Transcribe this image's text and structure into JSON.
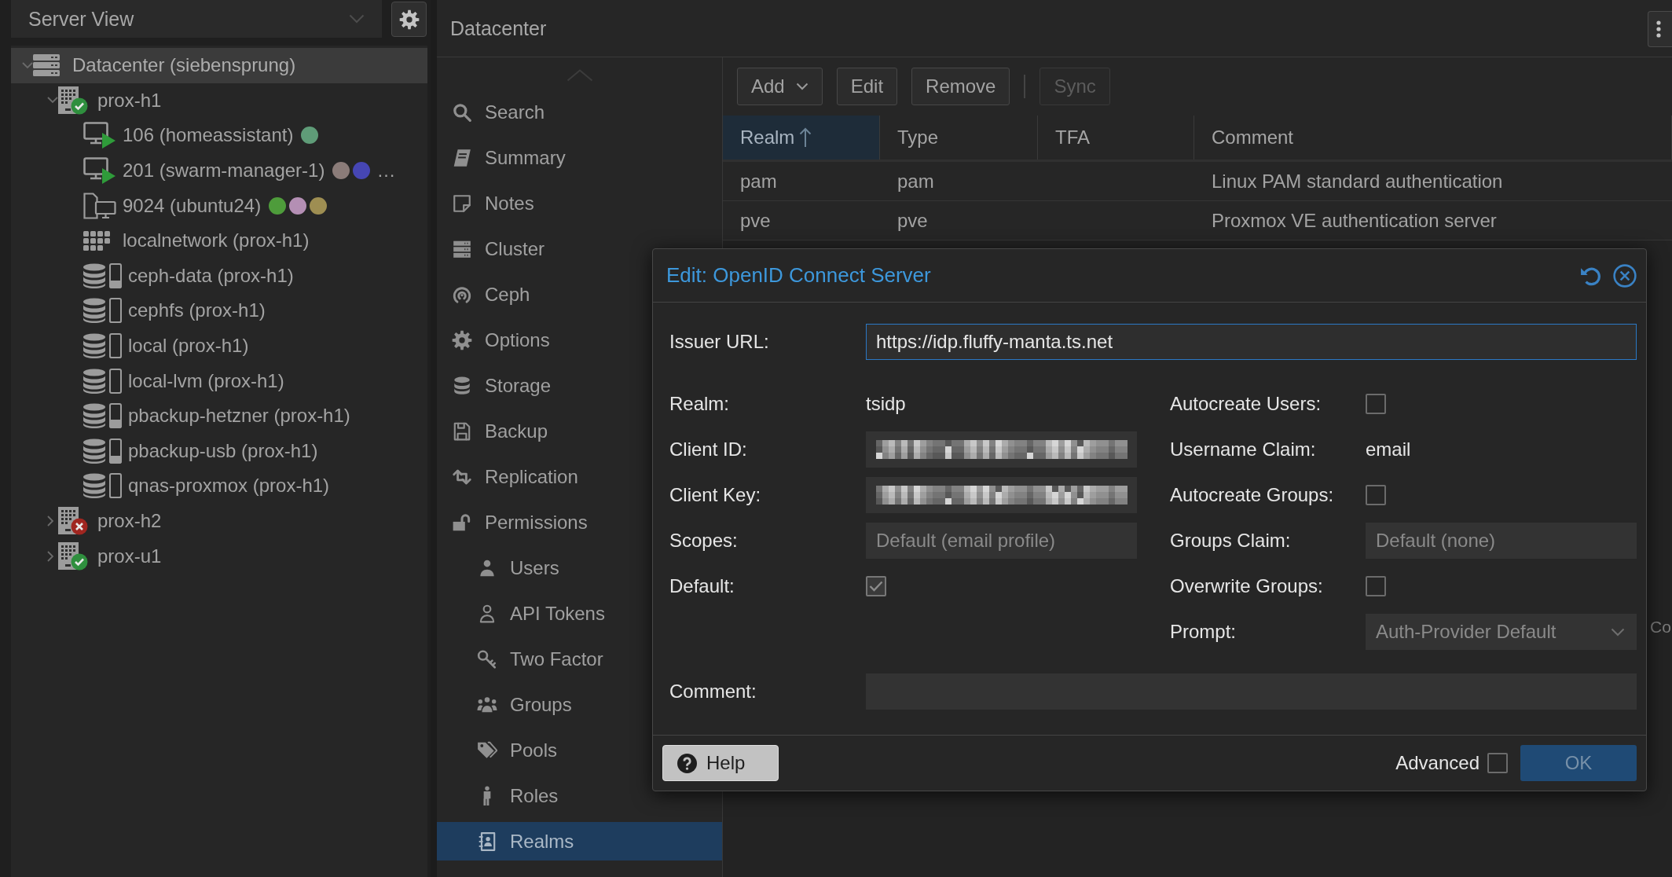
{
  "left_panel": {
    "view_select": {
      "value": "Server View"
    },
    "tree": {
      "label": "Datacenter (siebensprung)",
      "kind": "datacenter",
      "selected": true,
      "expanded": true,
      "children": [
        {
          "label": "prox-h1",
          "kind": "node",
          "online": true,
          "selected": false,
          "expanded": true,
          "children": [
            {
              "label": "106 (homeassistant)",
              "kind": "vm",
              "running": true,
              "selected": false,
              "tags": [
                {
                  "color": "#5f9c78"
                }
              ]
            },
            {
              "label": "201 (swarm-manager-1)",
              "kind": "vm",
              "running": true,
              "selected": false,
              "tags": [
                {
                  "color": "#8b7c79"
                },
                {
                  "color": "#4646b4"
                }
              ],
              "more": "…"
            },
            {
              "label": "9024 (ubuntu24)",
              "kind": "template",
              "selected": false,
              "tags": [
                {
                  "color": "#4e9c3b"
                },
                {
                  "color": "#b48fb4"
                },
                {
                  "color": "#9e8e52"
                }
              ]
            },
            {
              "label": "localnetwork (prox-h1)",
              "kind": "network",
              "selected": false
            },
            {
              "label": "ceph-data (prox-h1)",
              "kind": "storage",
              "level": 0.3,
              "selected": false
            },
            {
              "label": "cephfs (prox-h1)",
              "kind": "storage",
              "level": 0.08,
              "selected": false
            },
            {
              "label": "local (prox-h1)",
              "kind": "storage",
              "level": 0.08,
              "selected": false
            },
            {
              "label": "local-lvm (prox-h1)",
              "kind": "storage",
              "selected": false
            },
            {
              "label": "pbackup-hetzner (prox-h1)",
              "kind": "storage",
              "level": 0.35,
              "selected": false
            },
            {
              "label": "pbackup-usb (prox-h1)",
              "kind": "storage",
              "level": 0.3,
              "selected": false
            },
            {
              "label": "qnas-proxmox (prox-h1)",
              "kind": "storage",
              "level": 0.08,
              "selected": false
            }
          ]
        },
        {
          "label": "prox-h2",
          "kind": "node",
          "online": false,
          "selected": false,
          "expanded": false
        },
        {
          "label": "prox-u1",
          "kind": "node",
          "online": true,
          "selected": false,
          "expanded": false
        }
      ]
    }
  },
  "header": {
    "title": "Datacenter"
  },
  "nav": {
    "items": [
      {
        "label": "Search",
        "selected": false
      },
      {
        "label": "Summary",
        "selected": false
      },
      {
        "label": "Notes",
        "selected": false
      },
      {
        "label": "Cluster",
        "selected": false
      },
      {
        "label": "Ceph",
        "selected": false
      },
      {
        "label": "Options",
        "selected": false
      },
      {
        "label": "Storage",
        "selected": false
      },
      {
        "label": "Backup",
        "selected": false
      },
      {
        "label": "Replication",
        "selected": false
      },
      {
        "label": "Permissions",
        "selected": false,
        "children": [
          {
            "label": "Users",
            "selected": false
          },
          {
            "label": "API Tokens",
            "selected": false
          },
          {
            "label": "Two Factor",
            "selected": false
          },
          {
            "label": "Groups",
            "selected": false
          },
          {
            "label": "Pools",
            "selected": false
          },
          {
            "label": "Roles",
            "selected": false
          },
          {
            "label": "Realms",
            "selected": true
          }
        ]
      }
    ]
  },
  "toolbar": {
    "buttons": [
      {
        "label": "Add",
        "kind": "menu",
        "disabled": false
      },
      {
        "label": "Edit",
        "kind": "button",
        "disabled": false
      },
      {
        "label": "Remove",
        "kind": "button",
        "disabled": false
      },
      {
        "kind": "separator"
      },
      {
        "label": "Sync",
        "kind": "button",
        "disabled": true
      }
    ]
  },
  "table": {
    "columns": [
      {
        "label": "Realm",
        "sorted": true
      },
      {
        "label": "Type",
        "sorted": false
      },
      {
        "label": "TFA",
        "sorted": false
      },
      {
        "label": "Comment",
        "sorted": false
      }
    ],
    "rows": [
      {
        "realm": "pam",
        "type": "pam",
        "comment": "Linux PAM standard authentication"
      },
      {
        "realm": "pve",
        "type": "pve",
        "comment": "Proxmox VE authentication server"
      }
    ],
    "obscured_text": "Co"
  },
  "dialog": {
    "title": "Edit: OpenID Connect Server",
    "issuer": {
      "label": "Issuer URL:",
      "value": "https://idp.fluffy-manta.ts.net",
      "focused": true
    },
    "left_fields": [
      {
        "label": "Realm:",
        "kind": "text",
        "value": "tsidp"
      },
      {
        "label": "Client ID:",
        "kind": "redacted"
      },
      {
        "label": "Client Key:",
        "kind": "redacted"
      },
      {
        "label": "Scopes:",
        "kind": "input",
        "placeholder": "Default (email profile)"
      },
      {
        "label": "Default:",
        "kind": "checkbox",
        "checked": true
      }
    ],
    "right_fields": [
      {
        "label": "Autocreate Users:",
        "kind": "checkbox",
        "checked": false
      },
      {
        "label": "Username Claim:",
        "kind": "text",
        "value": "email"
      },
      {
        "label": "Autocreate Groups:",
        "kind": "checkbox",
        "checked": false
      },
      {
        "label": "Groups Claim:",
        "kind": "input",
        "placeholder": "Default (none)"
      },
      {
        "label": "Overwrite Groups:",
        "kind": "checkbox",
        "checked": false
      },
      {
        "label": "Prompt:",
        "kind": "select",
        "placeholder": "Auth-Provider Default"
      }
    ],
    "comment": {
      "label": "Comment:"
    },
    "help_button": {
      "label": "Help"
    },
    "advanced": {
      "label": "Advanced",
      "checked": false
    },
    "ok_button": {
      "label": "OK",
      "disabled": true
    }
  }
}
